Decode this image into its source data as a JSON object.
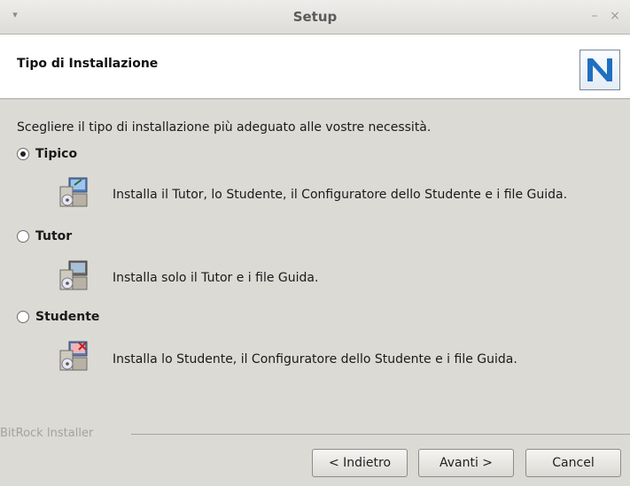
{
  "window": {
    "title": "Setup",
    "minimize_glyph": "–",
    "close_glyph": "×",
    "menu_glyph": "▾"
  },
  "header": {
    "title": "Tipo di Installazione",
    "logo_text": "N",
    "logo_color": "#1f6fc0"
  },
  "instruction": "Scegliere il tipo di installazione più adeguato alle vostre necessità.",
  "options": [
    {
      "label": "Tipico",
      "selected": true,
      "description": "Installa il Tutor, lo Studente, il Configuratore dello Studente e i file Guida.",
      "icon": "installer-package-icon"
    },
    {
      "label": "Tutor",
      "selected": false,
      "description": "Installa solo il Tutor e i file Guida.",
      "icon": "installer-package-icon"
    },
    {
      "label": "Studente",
      "selected": false,
      "description": "Installa lo Studente, il Configuratore dello Studente e i file Guida.",
      "icon": "installer-package-icon"
    }
  ],
  "footer": {
    "brand": "BitRock Installer"
  },
  "buttons": {
    "back": "< Indietro",
    "next": "Avanti >",
    "cancel": "Cancel"
  }
}
